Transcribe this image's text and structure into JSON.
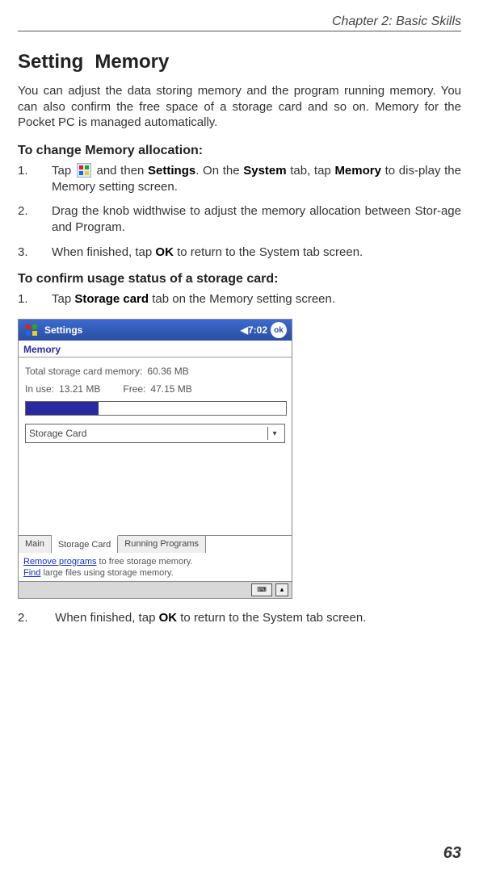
{
  "chapter": "Chapter 2: Basic Skills",
  "heading_part1": "Setting",
  "heading_part2": "Memory",
  "intro": "You can adjust the data storing memory and the program running memory. You can also confirm the free space of a storage card and so on. Memory for the Pocket PC is managed automatically.",
  "sectionA_title": "To change Memory allocation:",
  "sectionA_steps": {
    "s1_pre": "Tap ",
    "s1_mid1": " and then ",
    "s1_b1": "Settings",
    "s1_mid2": ". On the ",
    "s1_b2": "System",
    "s1_mid3": " tab, tap ",
    "s1_b3": "Memory",
    "s1_mid4": " to     dis-play the Memory setting screen.",
    "s2": "Drag the knob widthwise to adjust the memory allocation between Stor-age and Program.",
    "s3_pre": "When finished, tap ",
    "s3_b": "OK",
    "s3_post": " to return to the System tab screen."
  },
  "sectionB_title": "To confirm usage status of a storage card:",
  "sectionB_steps": {
    "s1_pre": "Tap ",
    "s1_b": "Storage card",
    "s1_post": " tab on the Memory setting screen.",
    "s2_pre": "When finished, tap ",
    "s2_b": "OK",
    "s2_post": " to return to the System tab screen."
  },
  "screenshot": {
    "title": "Settings",
    "time": "7:02",
    "ok": "ok",
    "tab_heading": "Memory",
    "total_label": "Total storage card memory:",
    "total_value": "60.36 MB",
    "inuse_label": "In use:",
    "inuse_value": "13.21 MB",
    "free_label": "Free:",
    "free_value": "47.15 MB",
    "dropdown_value": "Storage Card",
    "tabs": {
      "main": "Main",
      "storage": "Storage Card",
      "running": "Running Programs"
    },
    "hint1_link": "Remove programs",
    "hint1_rest": " to free storage memory.",
    "hint2_link": "Find",
    "hint2_rest": " large files using storage memory."
  },
  "page_number": "63"
}
